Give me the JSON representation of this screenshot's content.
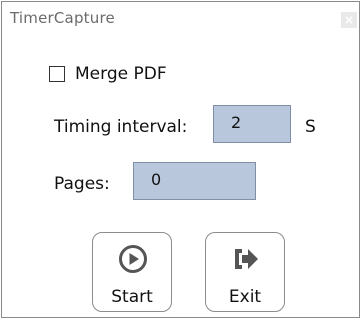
{
  "window": {
    "title": "TimerCapture",
    "close_icon": "close-icon"
  },
  "merge": {
    "label": "Merge PDF",
    "checked": false
  },
  "interval": {
    "label": "Timing interval:",
    "value": "2",
    "unit": "S"
  },
  "pages": {
    "label": "Pages:",
    "value": "0"
  },
  "buttons": {
    "start": {
      "label": "Start",
      "icon": "play-icon"
    },
    "exit": {
      "label": "Exit",
      "icon": "exit-icon"
    }
  },
  "colors": {
    "field_bg": "#b9c7dc",
    "icon_gray": "#555555"
  }
}
